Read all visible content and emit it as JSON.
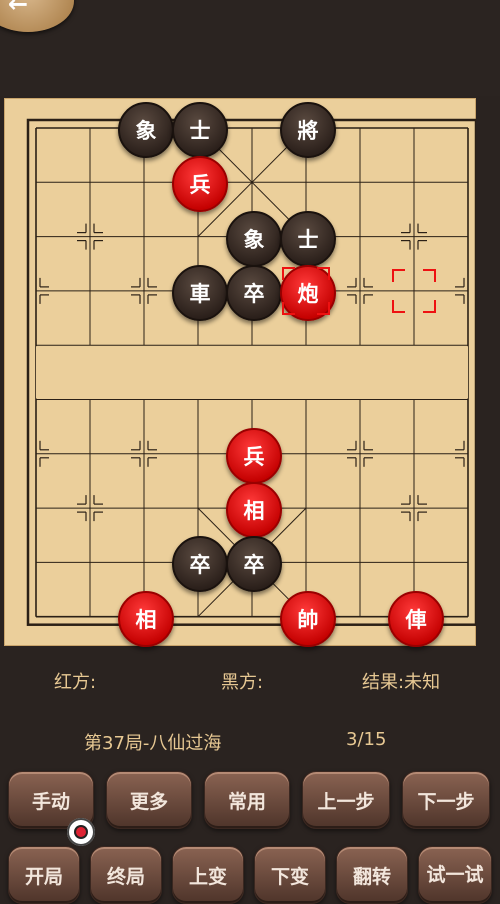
{
  "pieces": [
    {
      "char": "象",
      "side": "black",
      "col": 2,
      "row": 0
    },
    {
      "char": "士",
      "side": "black",
      "col": 3,
      "row": 0
    },
    {
      "char": "將",
      "side": "black",
      "col": 5,
      "row": 0
    },
    {
      "char": "兵",
      "side": "red",
      "col": 3,
      "row": 1
    },
    {
      "char": "象",
      "side": "black",
      "col": 4,
      "row": 2
    },
    {
      "char": "士",
      "side": "black",
      "col": 5,
      "row": 2
    },
    {
      "char": "車",
      "side": "black",
      "col": 3,
      "row": 3
    },
    {
      "char": "卒",
      "side": "black",
      "col": 4,
      "row": 3
    },
    {
      "char": "炮",
      "side": "red",
      "col": 5,
      "row": 3,
      "selected": true
    },
    {
      "char": "兵",
      "side": "red",
      "col": 4,
      "row": 6
    },
    {
      "char": "相",
      "side": "red",
      "col": 4,
      "row": 7
    },
    {
      "char": "卒",
      "side": "black",
      "col": 3,
      "row": 8
    },
    {
      "char": "卒",
      "side": "black",
      "col": 4,
      "row": 8
    },
    {
      "char": "相",
      "side": "red",
      "col": 2,
      "row": 9
    },
    {
      "char": "帥",
      "side": "red",
      "col": 5,
      "row": 9
    },
    {
      "char": "俥",
      "side": "red",
      "col": 7,
      "row": 9
    }
  ],
  "move_marker": {
    "col": 7,
    "row": 3
  },
  "info": {
    "red_label": "红方:",
    "black_label": "黑方:",
    "result": "结果:未知",
    "game_title": "第37局-八仙过海",
    "progress": "3/15"
  },
  "buttons_row1": [
    "手动",
    "更多",
    "常用",
    "上一步",
    "下一步"
  ],
  "buttons_row2": [
    "开局",
    "终局",
    "上变",
    "下变",
    "翻转",
    "试一试"
  ],
  "back_icon": "arrow-left-icon"
}
